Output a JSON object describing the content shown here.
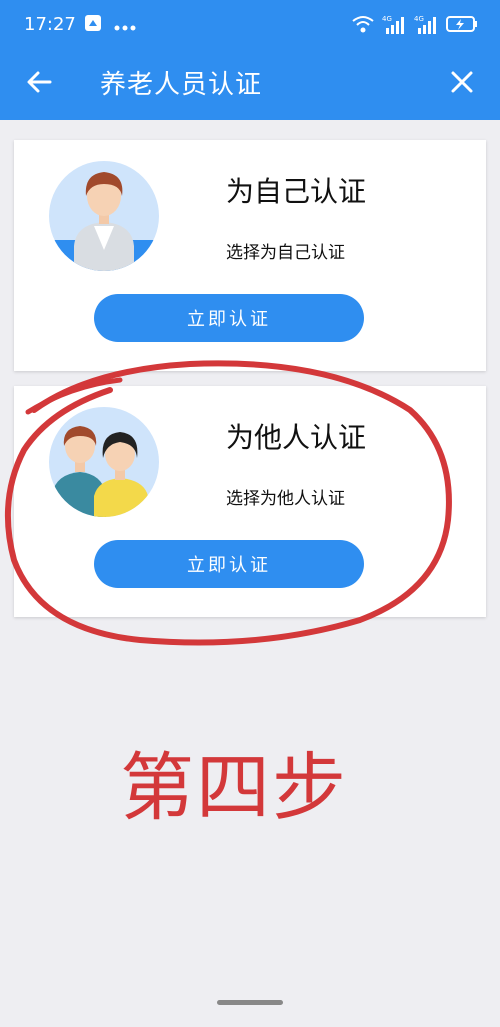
{
  "status": {
    "time": "17:27",
    "network_labels": [
      "4G",
      "4G"
    ]
  },
  "nav": {
    "title": "养老人员认证"
  },
  "cards": [
    {
      "title": "为自己认证",
      "subtitle": "选择为自己认证",
      "button_label": "立即认证"
    },
    {
      "title": "为他人认证",
      "subtitle": "选择为他人认证",
      "button_label": "立即认证"
    }
  ],
  "annotation": {
    "step_text": "第四步",
    "color": "#d3383a"
  },
  "colors": {
    "accent": "#2f8ef0",
    "background": "#eeeef2",
    "card": "#ffffff"
  },
  "icons": [
    "arrow-left-icon",
    "close-icon",
    "wifi-icon",
    "signal-icon",
    "battery-icon",
    "person-icon",
    "people-icon"
  ]
}
